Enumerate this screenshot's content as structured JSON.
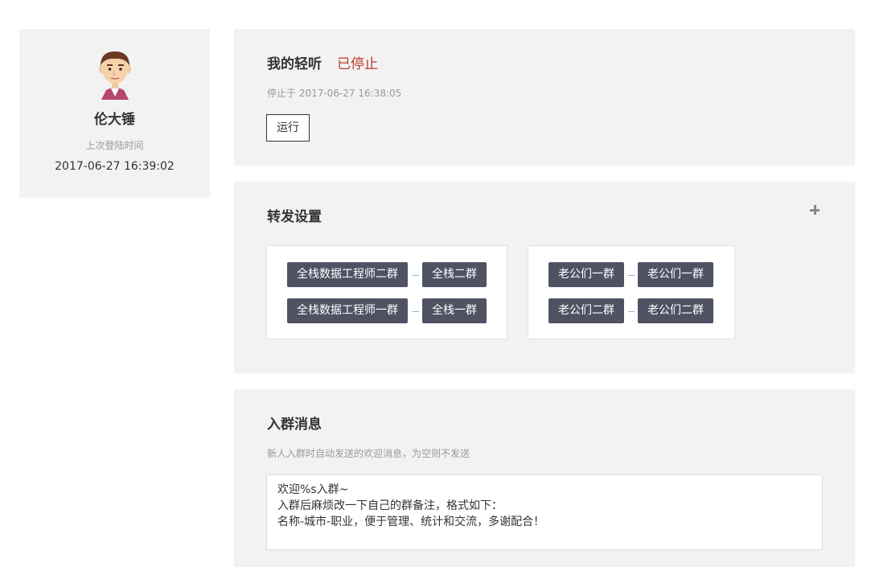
{
  "profile": {
    "name": "伦大锤",
    "last_login_label": "上次登陆时间",
    "last_login_time": "2017-06-27 16:39:02"
  },
  "status_panel": {
    "title": "我的轻听",
    "status": "已停止",
    "status_color": "#c0392b",
    "stopped_at": "停止于 2017-06-27 16:38:05",
    "run_label": "运行"
  },
  "forward_panel": {
    "title": "转发设置",
    "add_icon": "plus-icon",
    "groups": [
      {
        "pairs": [
          {
            "source": "全栈数据工程师二群",
            "target": "全栈二群"
          },
          {
            "source": "全栈数据工程师一群",
            "target": "全栈一群"
          }
        ]
      },
      {
        "pairs": [
          {
            "source": "老公们一群",
            "target": "老公们一群"
          },
          {
            "source": "老公们二群",
            "target": "老公们二群"
          }
        ]
      }
    ],
    "tag_color": "#4f5263"
  },
  "join_panel": {
    "title": "入群消息",
    "description": "新人入群时自动发送的欢迎消息，为空则不发送",
    "message_lines": [
      "欢迎%s入群~",
      "入群后麻烦改一下自己的群备注，格式如下：",
      "名称-城市-职业，便于管理、统计和交流，多谢配合！"
    ]
  }
}
